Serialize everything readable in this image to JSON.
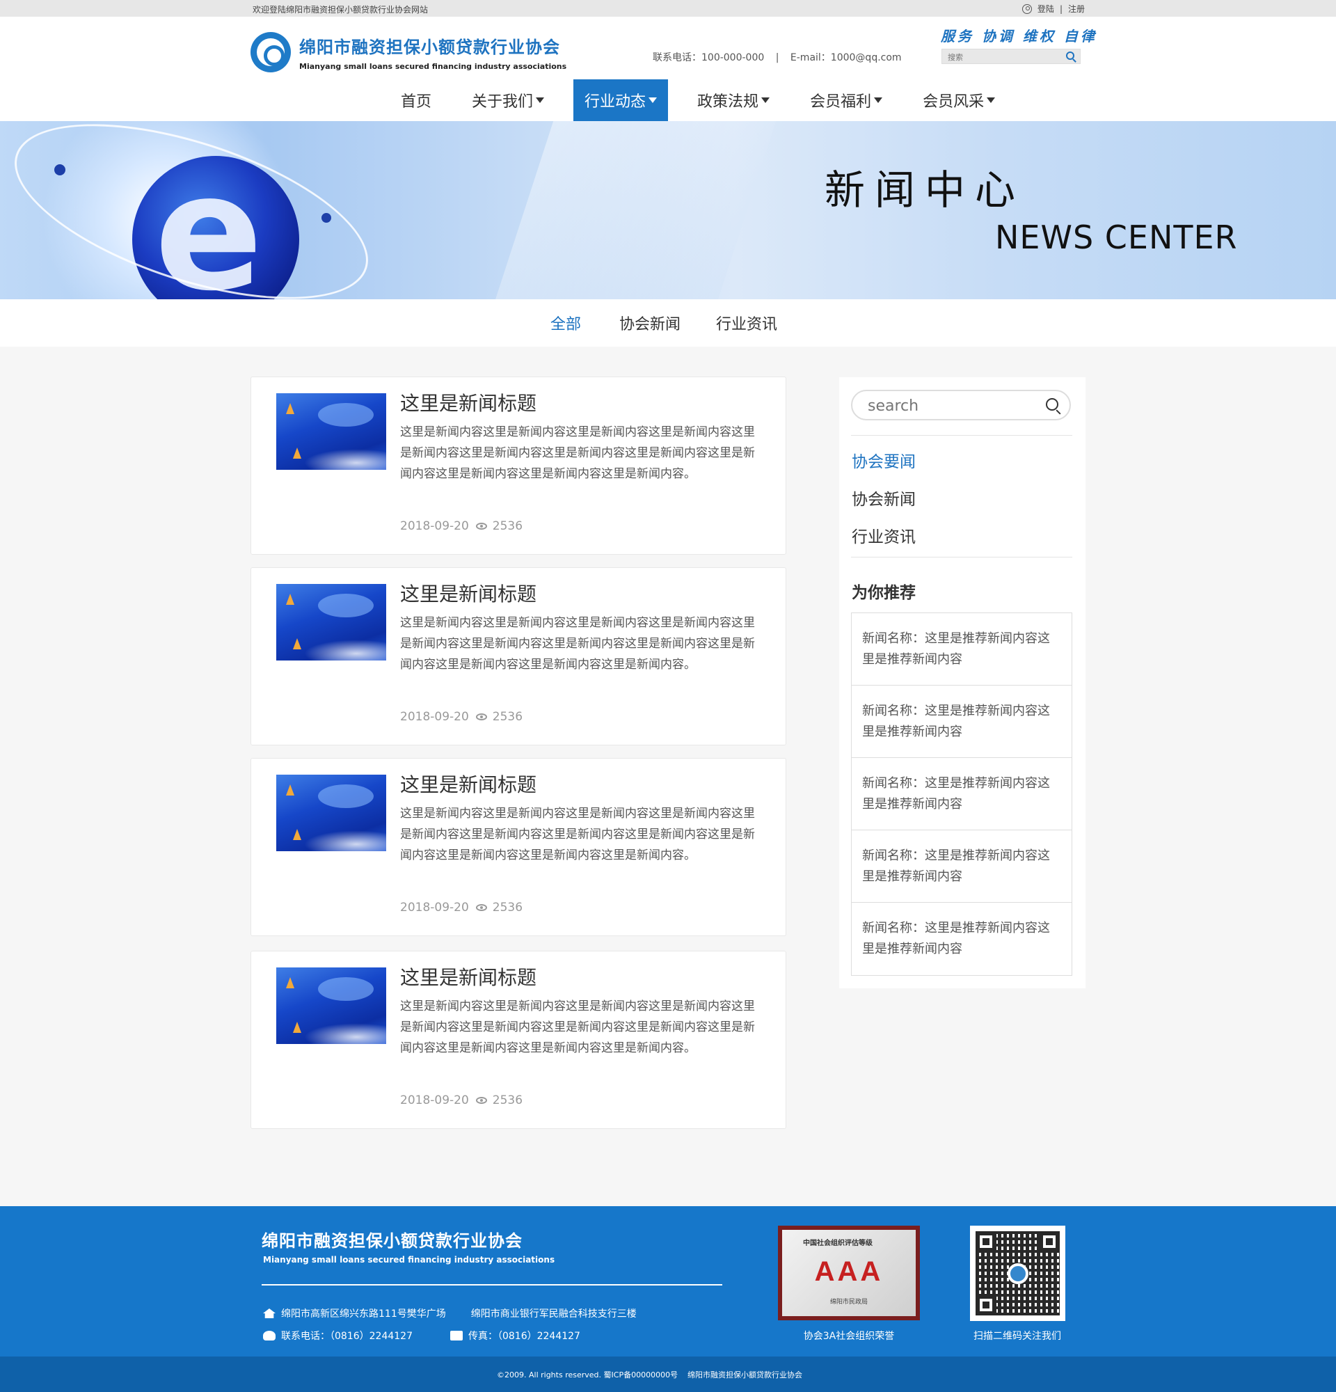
{
  "topbar": {
    "welcome": "欢迎登陆绵阳市融资担保小额贷款行业协会网站",
    "login": "登陆",
    "divider": "|",
    "register": "注册"
  },
  "header": {
    "logo_cn": "绵阳市融资担保小额贷款行业协会",
    "logo_en": "Mianyang small loans secured financing industry associations",
    "phone": "联系电话：100-000-000",
    "sep": "|",
    "email": "E-mail：1000@qq.com",
    "slogan": "服务 协调 维权 自律",
    "search_placeholder": "搜索"
  },
  "nav": [
    {
      "label": "首页"
    },
    {
      "label": "关于我们"
    },
    {
      "label": "行业动态"
    },
    {
      "label": "政策法规"
    },
    {
      "label": "会员福利"
    },
    {
      "label": "会员风采"
    }
  ],
  "banner": {
    "title_cn": "新闻中心",
    "title_en": "NEWS CENTER"
  },
  "tabs": [
    {
      "label": "全部"
    },
    {
      "label": "协会新闻"
    },
    {
      "label": "行业资讯"
    }
  ],
  "news": [
    {
      "title": "这里是新闻标题",
      "content": "这里是新闻内容这里是新闻内容这里是新闻内容这里是新闻内容这里是新闻内容这里是新闻内容这里是新闻内容这里是新闻内容这里是新闻内容这里是新闻内容这里是新闻内容这里是新闻内容。",
      "date": "2018-09-20",
      "views": "2536"
    },
    {
      "title": "这里是新闻标题",
      "content": "这里是新闻内容这里是新闻内容这里是新闻内容这里是新闻内容这里是新闻内容这里是新闻内容这里是新闻内容这里是新闻内容这里是新闻内容这里是新闻内容这里是新闻内容这里是新闻内容。",
      "date": "2018-09-20",
      "views": "2536"
    },
    {
      "title": "这里是新闻标题",
      "content": "这里是新闻内容这里是新闻内容这里是新闻内容这里是新闻内容这里是新闻内容这里是新闻内容这里是新闻内容这里是新闻内容这里是新闻内容这里是新闻内容这里是新闻内容这里是新闻内容。",
      "date": "2018-09-20",
      "views": "2536"
    },
    {
      "title": "这里是新闻标题",
      "content": "这里是新闻内容这里是新闻内容这里是新闻内容这里是新闻内容这里是新闻内容这里是新闻内容这里是新闻内容这里是新闻内容这里是新闻内容这里是新闻内容这里是新闻内容这里是新闻内容。",
      "date": "2018-09-20",
      "views": "2536"
    }
  ],
  "sidebar": {
    "search_placeholder": "search",
    "categories": [
      {
        "label": "协会要闻"
      },
      {
        "label": "协会新闻"
      },
      {
        "label": "行业资讯"
      }
    ],
    "rec_title": "为你推荐",
    "recommendations": [
      {
        "text": "新闻名称：这里是推荐新闻内容这里是推荐新闻内容"
      },
      {
        "text": "新闻名称：这里是推荐新闻内容这里是推荐新闻内容"
      },
      {
        "text": "新闻名称：这里是推荐新闻内容这里是推荐新闻内容"
      },
      {
        "text": "新闻名称：这里是推荐新闻内容这里是推荐新闻内容"
      },
      {
        "text": "新闻名称：这里是推荐新闻内容这里是推荐新闻内容"
      }
    ]
  },
  "footer": {
    "name_cn": "绵阳市融资担保小额贷款行业协会",
    "name_en": "Mianyang small loans secured financing industry associations",
    "address1": "绵阳市高新区绵兴东路111号樊华广场",
    "address2": "绵阳市商业银行军民融合科技支行三楼",
    "phone": "联系电话：（0816）2244127",
    "fax": "传真：（0816）2244127",
    "award_org": "中国社会组织评估等级",
    "award_grade": "AAA",
    "award_bureau": "绵阳市民政局",
    "award_caption": "协会3A社会组织荣誉",
    "qr_caption": "扫描二维码关注我们",
    "copyright": "©2009. All rights reserved. 蜀ICP备00000000号",
    "copyright_org": "绵阳市融资担保小额贷款行业协会"
  },
  "colors": {
    "brand_blue": "#1e73c0",
    "nav_active": "#1b76c6",
    "footer_bg": "#1677ca"
  },
  "icons": [
    "user-icon",
    "search-icon",
    "caret-down-icon",
    "eye-icon",
    "home-icon",
    "phone-icon",
    "fax-icon",
    "qr-code"
  ]
}
